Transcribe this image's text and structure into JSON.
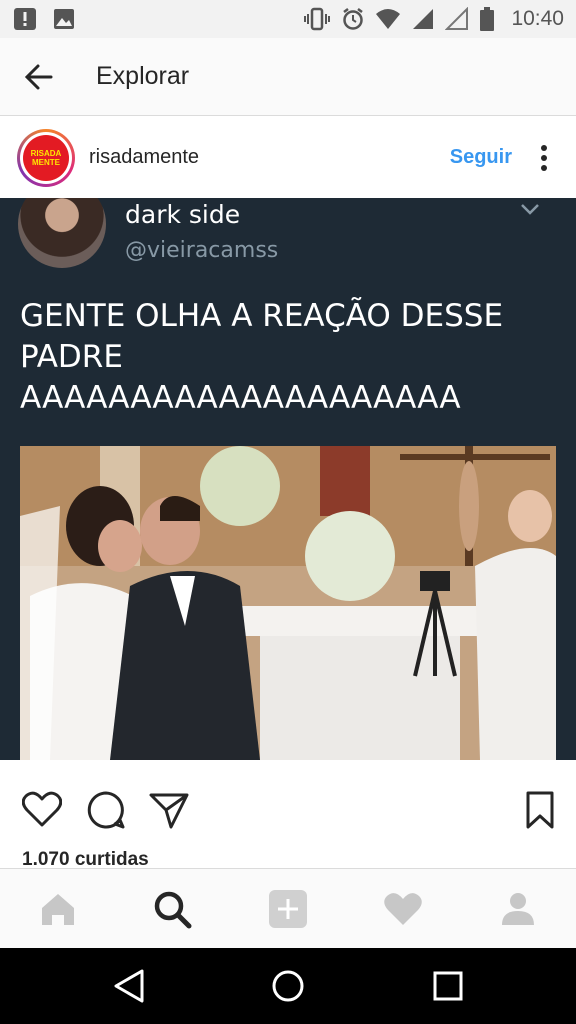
{
  "status_bar": {
    "time": "10:40"
  },
  "app_bar": {
    "title": "Explorar"
  },
  "post": {
    "username": "risadamente",
    "follow_label": "Seguir",
    "avatar_text": "RISADA MENTE",
    "image": {
      "tweet_name": "dark side",
      "tweet_handle": "@vieiracamss",
      "tweet_text": "GENTE OLHA A REAÇÃO DESSE PADRE AAAAAAAAAAAAAAAAAAAA"
    },
    "likes": "1.070 curtidas"
  },
  "colors": {
    "accent": "#3897f0",
    "tweet_bg": "#1e2a35"
  },
  "tabs": [
    "home-icon",
    "search-icon",
    "add-icon",
    "heart-icon",
    "profile-icon"
  ]
}
